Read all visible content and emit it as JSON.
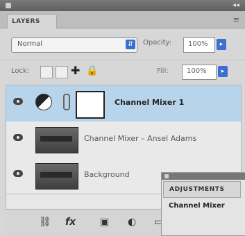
{
  "panel": {
    "tab_label": "LAYERS",
    "menu_icon": "panel-menu-icon"
  },
  "controls": {
    "blend_mode": "Normal",
    "opacity_label": "Opacity:",
    "opacity_value": "100%",
    "lock_label": "Lock:",
    "fill_label": "Fill:",
    "fill_value": "100%"
  },
  "layers": [
    {
      "name": "Channel Mixer 1",
      "type": "adjustment",
      "selected": true
    },
    {
      "name": "Channel Mixer – Ansel Adams",
      "type": "pixel",
      "selected": false
    },
    {
      "name": "Background",
      "type": "pixel",
      "selected": false
    }
  ],
  "adjustments_panel": {
    "tab_label": "ADJUSTMENTS",
    "label": "Channel Mixer"
  },
  "bottom_icons": [
    "link-icon",
    "fx-icon",
    "mask-icon",
    "adjustment-icon",
    "folder-icon"
  ],
  "colors": {
    "selection_blue": "#b8d4ea",
    "dropdown_blue": "#3b6fd0"
  }
}
